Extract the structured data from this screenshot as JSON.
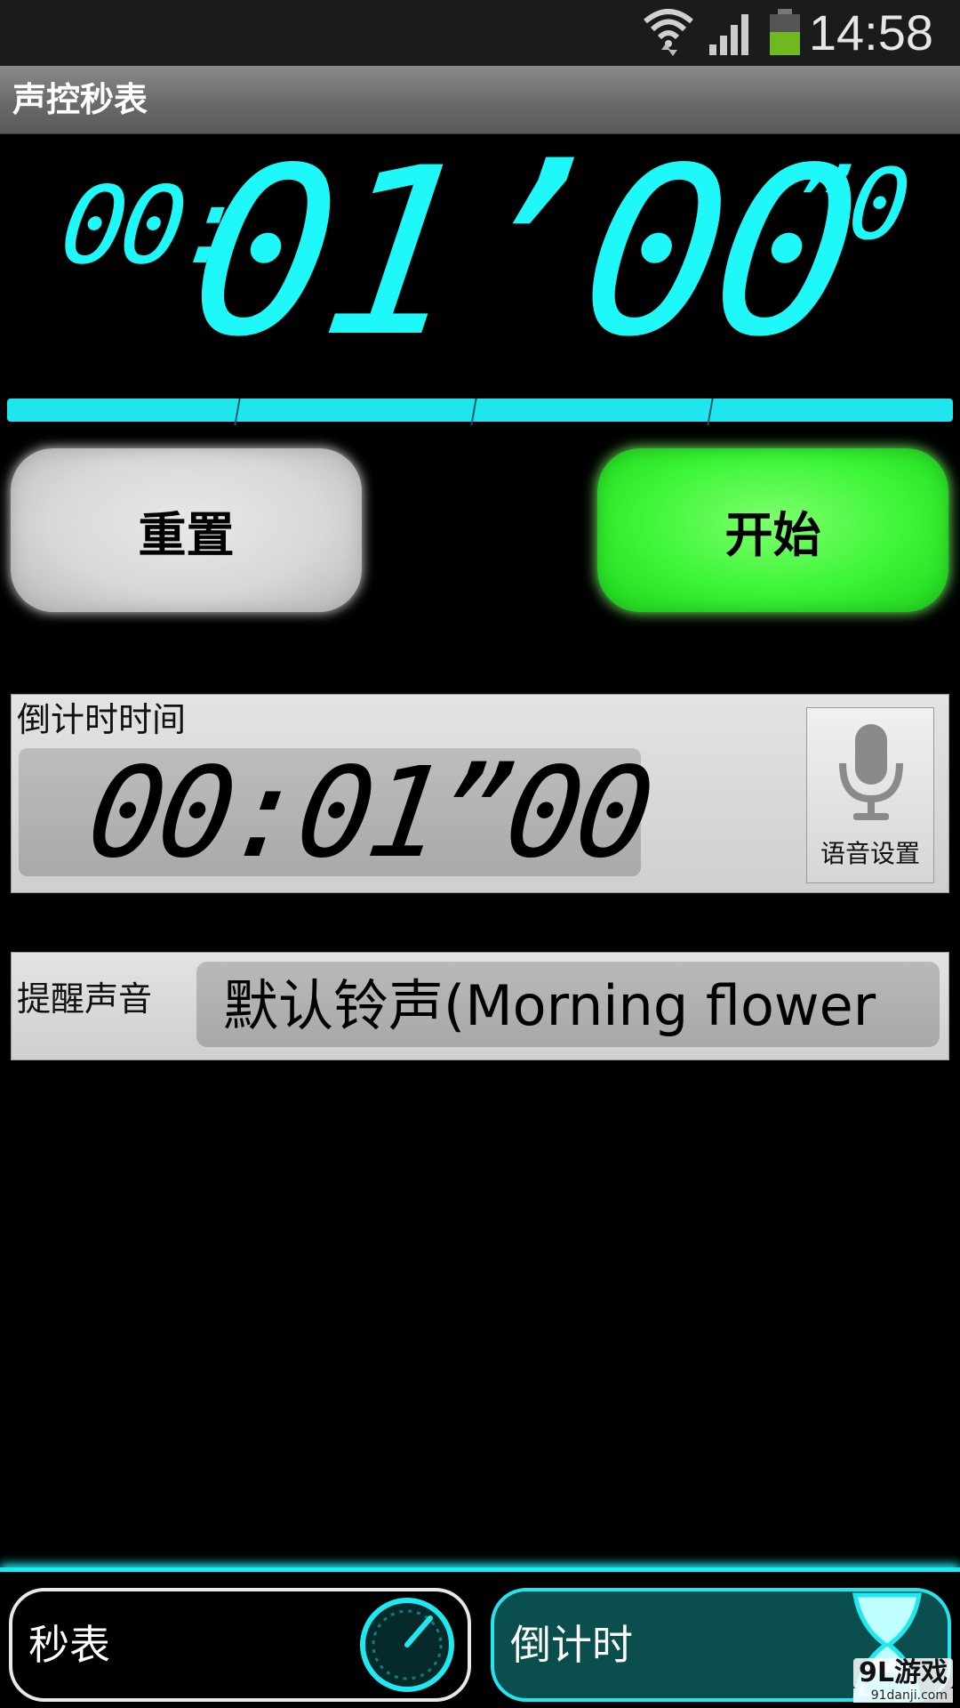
{
  "status_bar": {
    "time": "14:58",
    "battery_color": "#6fb81f"
  },
  "app": {
    "title": "声控秒表"
  },
  "display": {
    "hours": "00:",
    "main": "01’00",
    "tenths": "”0",
    "color": "#1ef8f8"
  },
  "buttons": {
    "reset": "重置",
    "start": "开始"
  },
  "countdown": {
    "label": "倒计时时间",
    "value": "00:01”00",
    "voice_label": "语音设置"
  },
  "sound": {
    "label": "提醒声音",
    "value": "默认铃声(Morning flower"
  },
  "tabs": {
    "stopwatch": "秒表",
    "countdown": "倒计时",
    "accent": "#1ee8f0"
  },
  "watermark": {
    "main": "9L游戏",
    "sub": "91danji.com"
  }
}
